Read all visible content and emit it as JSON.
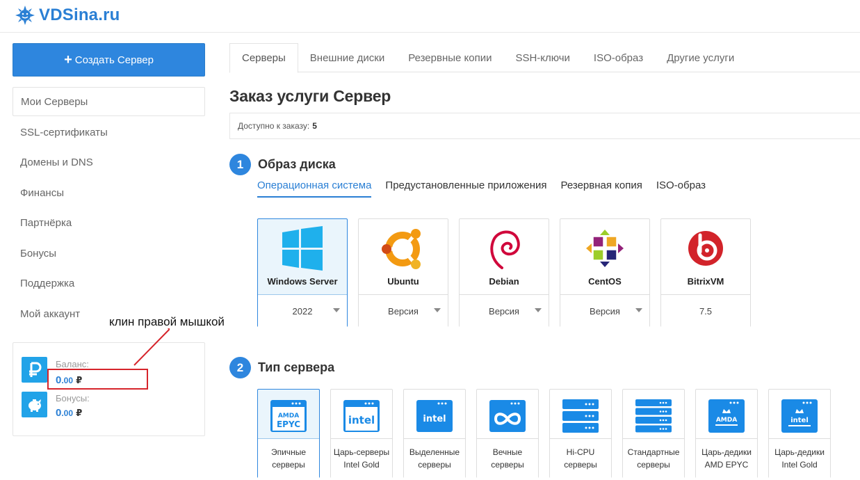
{
  "logo": {
    "text": "VDSina.ru",
    "icon": "sun-logo-icon"
  },
  "sidebar": {
    "create_button": {
      "label": "Создать Сервер",
      "icon": "plus-icon"
    },
    "items": [
      {
        "label": "Мои Серверы",
        "active": true
      },
      {
        "label": "SSL-сертификаты"
      },
      {
        "label": "Домены и DNS"
      },
      {
        "label": "Финансы"
      },
      {
        "label": "Партнёрка"
      },
      {
        "label": "Бонусы"
      },
      {
        "label": "Поддержка"
      },
      {
        "label": "Мой аккаунт"
      }
    ],
    "balance": {
      "label": "Баланс:",
      "int": "0",
      "frac": ".00",
      "currency": "₽",
      "icon": "ruble-icon"
    },
    "bonuses": {
      "label": "Бонусы:",
      "int": "0",
      "frac": ".00",
      "currency": "₽",
      "icon": "piggy-bank-icon"
    }
  },
  "annotation": {
    "text": "клин правой мышкой",
    "color": "#d6242b"
  },
  "tabs": [
    {
      "label": "Серверы",
      "active": true
    },
    {
      "label": "Внешние диски"
    },
    {
      "label": "Резервные копии"
    },
    {
      "label": "SSH-ключи"
    },
    {
      "label": "ISO-образ"
    },
    {
      "label": "Другие услуги"
    }
  ],
  "page": {
    "title": "Заказ услуги Сервер",
    "available_label": "Доступно к заказу:",
    "available_value": "5"
  },
  "step1": {
    "number": "1",
    "title": "Образ диска",
    "subtabs": [
      {
        "label": "Операционная система",
        "active": true
      },
      {
        "label": "Предустановленные приложения"
      },
      {
        "label": "Резервная копия"
      },
      {
        "label": "ISO-образ"
      }
    ],
    "os": [
      {
        "name": "Windows Server",
        "version": "2022",
        "icon": "windows-icon",
        "selected": true,
        "dropdown": true
      },
      {
        "name": "Ubuntu",
        "version": "Версия",
        "icon": "ubuntu-icon",
        "dropdown": true
      },
      {
        "name": "Debian",
        "version": "Версия",
        "icon": "debian-icon",
        "dropdown": true
      },
      {
        "name": "CentOS",
        "version": "Версия",
        "icon": "centos-icon",
        "dropdown": true
      },
      {
        "name": "BitrixVM",
        "version": "7.5",
        "icon": "bitrix-icon",
        "dropdown": false
      }
    ]
  },
  "step2": {
    "number": "2",
    "title": "Тип сервера",
    "servers": [
      {
        "line1": "Эпичные",
        "line2": "серверы",
        "icon": "amd-epyc-icon",
        "selected": true
      },
      {
        "line1": "Царь-серверы",
        "line2": "Intel Gold",
        "icon": "intel-gold-icon"
      },
      {
        "line1": "Выделенные",
        "line2": "серверы",
        "icon": "intel-dedicated-icon"
      },
      {
        "line1": "Вечные",
        "line2": "серверы",
        "icon": "infinity-icon"
      },
      {
        "line1": "Hi-CPU",
        "line2": "серверы",
        "icon": "hi-cpu-icon"
      },
      {
        "line1": "Стандартные",
        "line2": "серверы",
        "icon": "standard-server-icon"
      },
      {
        "line1": "Царь-дедики",
        "line2": "AMD EPYC",
        "icon": "crown-amd-icon"
      },
      {
        "line1": "Царь-дедики",
        "line2": "Intel Gold",
        "icon": "crown-intel-icon"
      }
    ]
  },
  "colors": {
    "accent": "#2e86de",
    "link": "#2a7fd4",
    "selected_bg": "#eaf5fc",
    "balance_icon": "#22a3e8",
    "server_icon": "#1a8ae6"
  }
}
